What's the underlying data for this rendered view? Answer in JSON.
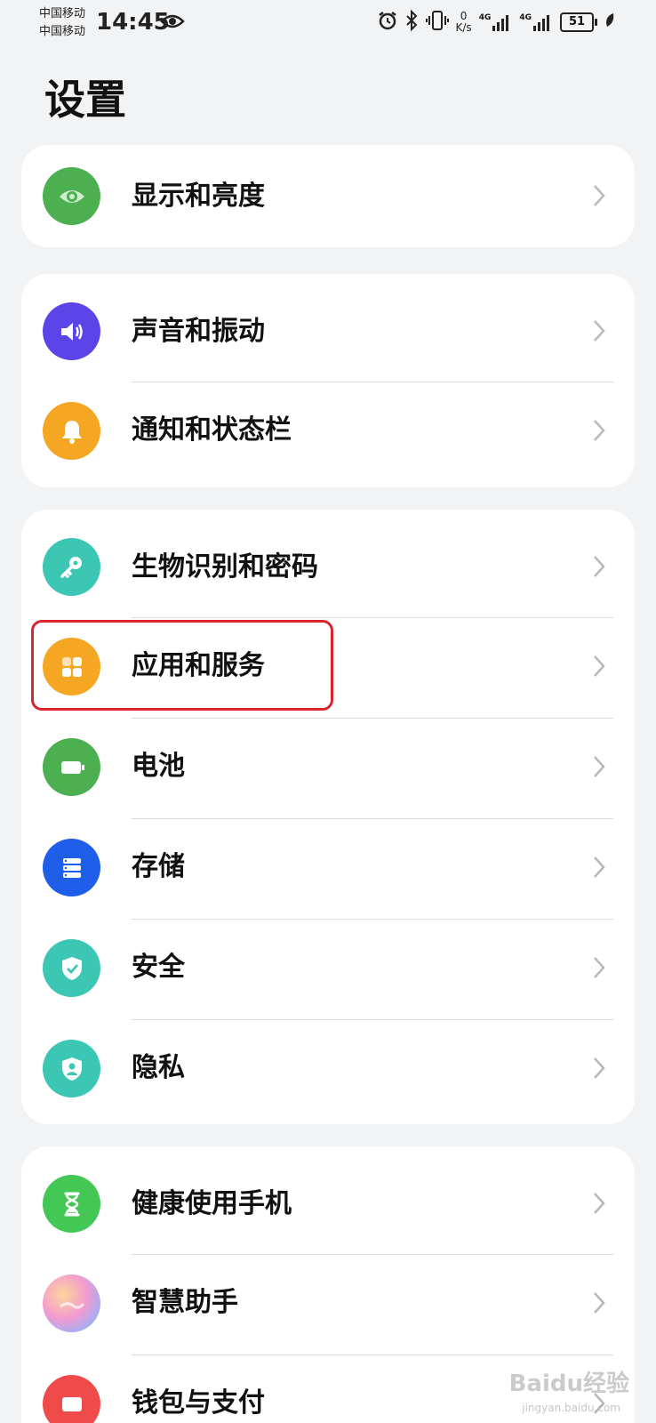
{
  "status_bar": {
    "carrier_1": "中国移动",
    "carrier_2": "中国移动",
    "time": "14:45",
    "net_speed_value": "0",
    "net_speed_unit": "K/s",
    "signal_1_label": "4G",
    "signal_2_label": "4G",
    "battery": "51",
    "icons": [
      "eye-icon",
      "alarm-icon",
      "bluetooth-icon",
      "vibrate-icon",
      "signal-icon",
      "signal-icon",
      "battery-icon",
      "leaf-icon"
    ]
  },
  "page": {
    "title": "设置"
  },
  "settings": {
    "display": {
      "label": "显示和亮度",
      "icon": "eye-icon",
      "color": "#4caf50"
    },
    "sound": {
      "label": "声音和振动",
      "icon": "speaker-icon",
      "color": "#5b45e8"
    },
    "notifications": {
      "label": "通知和状态栏",
      "icon": "bell-icon",
      "color": "#f5a623"
    },
    "biometrics": {
      "label": "生物识别和密码",
      "icon": "key-icon",
      "color": "#3cc6b4"
    },
    "apps": {
      "label": "应用和服务",
      "icon": "apps-grid-icon",
      "color": "#f5a623",
      "highlighted": true
    },
    "battery": {
      "label": "电池",
      "icon": "battery-icon",
      "color": "#4caf50"
    },
    "storage": {
      "label": "存储",
      "icon": "storage-icon",
      "color": "#1f5ee8"
    },
    "security": {
      "label": "安全",
      "icon": "shield-check-icon",
      "color": "#3cc6b4"
    },
    "privacy": {
      "label": "隐私",
      "icon": "privacy-shield-icon",
      "color": "#3cc6b4"
    },
    "health": {
      "label": "健康使用手机",
      "icon": "hourglass-icon",
      "color": "#43c755"
    },
    "assistant": {
      "label": "智慧助手",
      "icon": "assistant-orb-icon",
      "color": "#f29bd0"
    },
    "wallet": {
      "label": "钱包与支付",
      "icon": "wallet-icon",
      "color": "#f04b4b"
    }
  },
  "watermark": {
    "text": "Baidu经验",
    "sub": "jingyan.baidu.com"
  }
}
